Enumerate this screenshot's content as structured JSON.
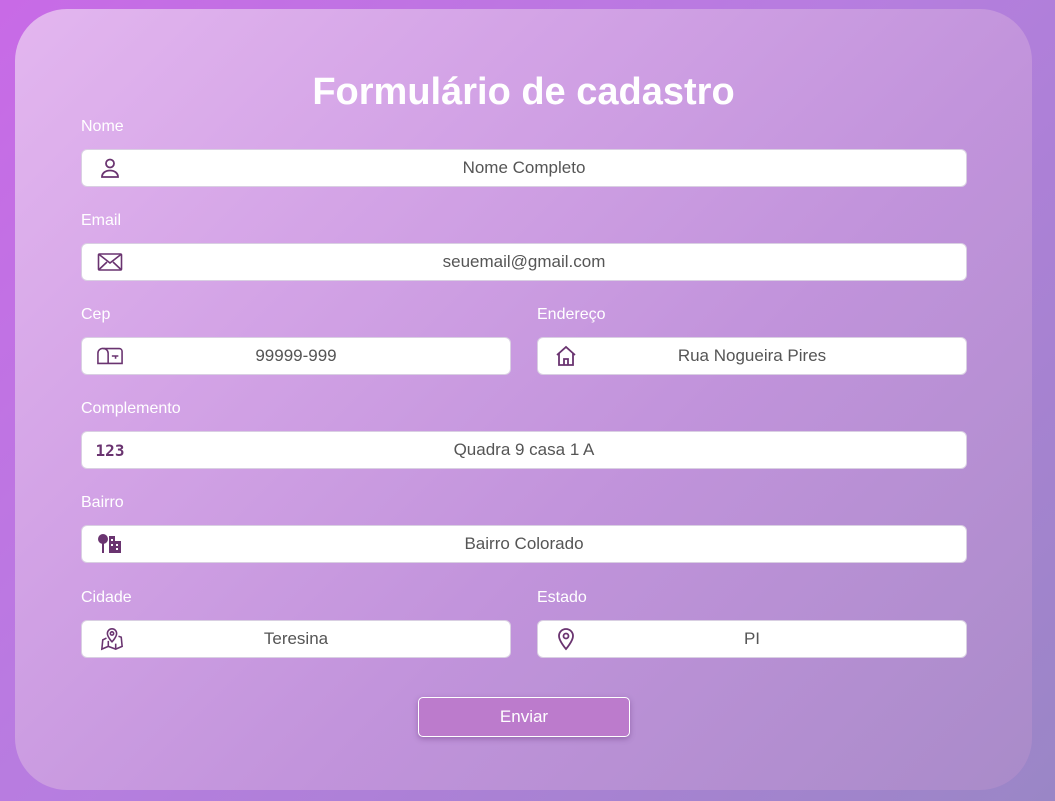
{
  "form": {
    "title": "Formulário de cadastro",
    "submit_label": "Enviar",
    "fields": {
      "nome": {
        "label": "Nome",
        "placeholder": "Nome Completo",
        "icon": "user-icon"
      },
      "email": {
        "label": "Email",
        "placeholder": "seuemail@gmail.com",
        "icon": "envelope-icon"
      },
      "cep": {
        "label": "Cep",
        "placeholder": "99999-999",
        "icon": "mailbox-icon"
      },
      "endereco": {
        "label": "Endereço",
        "placeholder": "Rua Nogueira Pires",
        "icon": "house-icon"
      },
      "complemento": {
        "label": "Complemento",
        "placeholder": "Quadra 9 casa 1 A",
        "icon": "numbers-icon",
        "icon_text": "123"
      },
      "bairro": {
        "label": "Bairro",
        "placeholder": "Bairro Colorado",
        "icon": "neighborhood-icon"
      },
      "cidade": {
        "label": "Cidade",
        "placeholder": "Teresina",
        "icon": "map-icon"
      },
      "estado": {
        "label": "Estado",
        "placeholder": "PI",
        "icon": "location-pin-icon"
      }
    }
  },
  "colors": {
    "background": "#c86ae6",
    "card": "#d3a3e6",
    "icon": "#6a3470",
    "button": "#bc7bcc"
  }
}
